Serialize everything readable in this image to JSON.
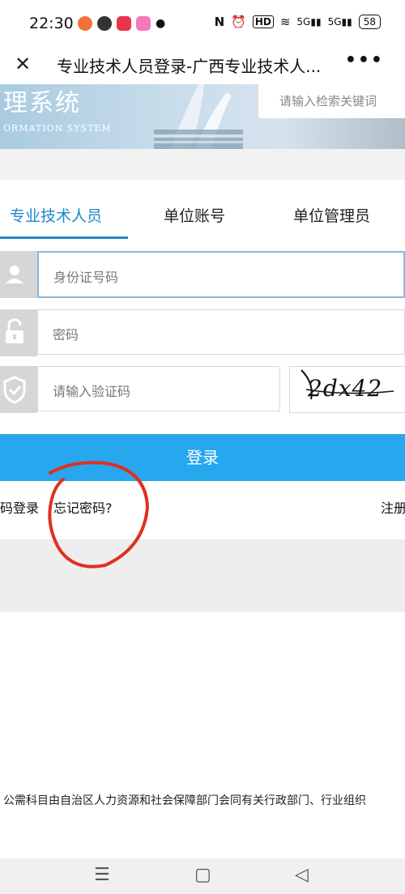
{
  "status_bar": {
    "time": "22:30",
    "network_labels": [
      "5G",
      "5G"
    ],
    "hd_label": "HD",
    "battery": "58"
  },
  "title_bar": {
    "title": "专业技术人员登录-广西专业技术人..."
  },
  "banner": {
    "logo_text": "理系统",
    "logo_sub": "ORMATION SYSTEM",
    "search_placeholder": "请输入检索关键词"
  },
  "tabs": [
    {
      "label": "专业技术人员",
      "active": true
    },
    {
      "label": "单位账号",
      "active": false
    },
    {
      "label": "单位管理员",
      "active": false
    }
  ],
  "form": {
    "id_placeholder": "身份证号码",
    "password_placeholder": "密码",
    "captcha_placeholder": "请输入验证码",
    "captcha_text": "2dx42",
    "login_label": "登录"
  },
  "links": {
    "scan_login": "扫码登录",
    "forgot_password": "忘记密码?",
    "register": "注册"
  },
  "footer": {
    "text": "公需科目由自治区人力资源和社会保障部门会同有关行政部门、行业组织"
  },
  "colors": {
    "accent": "#1e86cf",
    "login_button": "#27a7ee",
    "annotation": "#e03020"
  }
}
